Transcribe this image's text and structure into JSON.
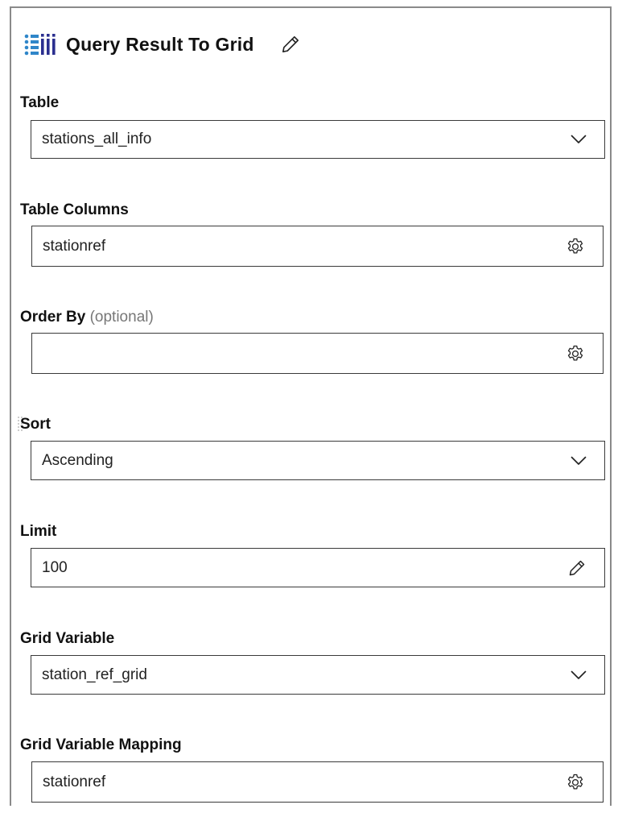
{
  "header": {
    "title": "Query Result To Grid",
    "logo_icon": "grid-list-icon",
    "edit_icon": "pencil-icon"
  },
  "fields": {
    "table": {
      "label": "Table",
      "value": "stations_all_info",
      "control": "dropdown",
      "icon": "chevron-down-icon"
    },
    "table_columns": {
      "label": "Table Columns",
      "value": "stationref",
      "control": "settings",
      "icon": "gear-icon"
    },
    "order_by": {
      "label": "Order By",
      "optional_note": "(optional)",
      "value": "",
      "control": "settings",
      "icon": "gear-icon"
    },
    "sort": {
      "label": "Sort",
      "value": "Ascending",
      "control": "dropdown",
      "icon": "chevron-down-icon"
    },
    "limit": {
      "label": "Limit",
      "value": "100",
      "control": "edit",
      "icon": "pencil-icon"
    },
    "grid_variable": {
      "label": "Grid Variable",
      "value": "station_ref_grid",
      "control": "dropdown",
      "icon": "chevron-down-icon"
    },
    "grid_variable_mapping": {
      "label": "Grid Variable Mapping",
      "value": "stationref",
      "control": "settings",
      "icon": "gear-icon"
    }
  },
  "colors": {
    "logo_blue": "#2f86c9",
    "logo_navy": "#2b2f8f",
    "border": "#3a3a3a",
    "frame": "#8a8a8a",
    "optional_text": "#777777"
  }
}
